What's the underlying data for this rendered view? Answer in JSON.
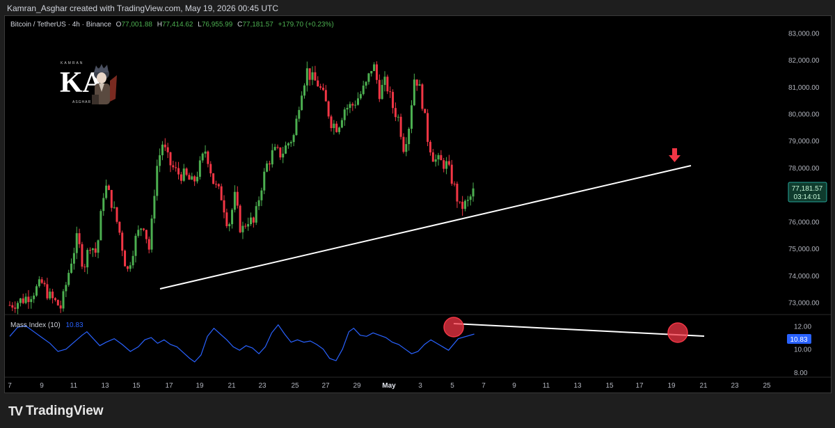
{
  "header": {
    "attribution": "Kamran_Asghar created with TradingView.com, May 19, 2026 00:45 UTC"
  },
  "footer": {
    "brand": "TradingView"
  },
  "logo": {
    "letters": "KA",
    "top": "KAMRAN",
    "bottom": "ASGHAR"
  },
  "colors": {
    "up": "#4caf50",
    "down": "#f23645",
    "indicator": "#2962ff",
    "trend": "#ffffff"
  },
  "chart_data": [
    {
      "type": "candlestick",
      "symbol": "Bitcoin / TetherUS · 4h · Binance",
      "ohlc": {
        "o_label": "O",
        "o": "77,001.88",
        "h_label": "H",
        "h": "77,414.62",
        "l_label": "L",
        "l": "76,955.99",
        "c_label": "C",
        "c": "77,181.57",
        "change": "+179.70 (+0.23%)"
      },
      "last_price": "77,181.57",
      "countdown": "03:14:01",
      "ylim": [
        72600,
        83500
      ],
      "yticks": [
        "83,000.00",
        "82,000.00",
        "81,000.00",
        "80,000.00",
        "79,000.00",
        "78,000.00",
        "76,000.00",
        "75,000.00",
        "74,000.00",
        "73,000.00"
      ],
      "ytick_values": [
        83000,
        82000,
        81000,
        80000,
        79000,
        78000,
        76000,
        75000,
        74000,
        73000
      ],
      "xlim": [
        6.5,
        26.2
      ],
      "xticks": [
        "7",
        "9",
        "11",
        "13",
        "15",
        "17",
        "19",
        "21",
        "23",
        "25",
        "27",
        "29",
        "May",
        "3",
        "5",
        "7",
        "9",
        "11",
        "13",
        "15",
        "17",
        "19",
        "21",
        "23",
        "25"
      ],
      "xtick_positions": [
        7,
        8.15,
        9.3,
        10.45,
        11.6,
        12.75,
        13.9,
        15.05,
        16.2,
        17.35,
        18.5,
        19.65,
        20.8,
        21.95,
        23.1,
        24.25,
        25.4,
        26.55,
        27.7,
        28.85,
        30,
        31.15,
        32.3,
        33.45,
        34.6
      ],
      "waypoints": [
        [
          7.0,
          72900
        ],
        [
          7.8,
          73100
        ],
        [
          8.3,
          73300
        ],
        [
          9.0,
          73700
        ],
        [
          9.5,
          73200
        ],
        [
          10.2,
          72800
        ],
        [
          10.8,
          74500
        ],
        [
          11.2,
          75400
        ],
        [
          11.6,
          74300
        ],
        [
          12.0,
          75200
        ],
        [
          12.4,
          74800
        ],
        [
          12.9,
          77400
        ],
        [
          13.3,
          76800
        ],
        [
          13.8,
          75700
        ],
        [
          14.3,
          74100
        ],
        [
          14.8,
          75300
        ],
        [
          15.3,
          76000
        ],
        [
          15.7,
          74900
        ],
        [
          16.1,
          77900
        ],
        [
          16.5,
          78900
        ],
        [
          16.9,
          78200
        ],
        [
          17.4,
          77800
        ],
        [
          17.9,
          77700
        ],
        [
          18.4,
          77400
        ],
        [
          18.8,
          78000
        ],
        [
          19.2,
          78700
        ],
        [
          19.7,
          77400
        ],
        [
          20.2,
          76900
        ],
        [
          20.6,
          75800
        ],
        [
          21.0,
          76900
        ],
        [
          21.4,
          75600
        ],
        [
          21.8,
          76100
        ],
        [
          22.2,
          75900
        ],
        [
          22.6,
          77200
        ],
        [
          23.0,
          78100
        ],
        [
          23.4,
          78600
        ],
        [
          23.9,
          78500
        ],
        [
          24.3,
          78900
        ],
        [
          24.7,
          79200
        ],
        [
          25.1,
          80800
        ],
        [
          25.5,
          81600
        ],
        [
          25.8,
          81300
        ],
        [
          26.2,
          81100
        ],
        [
          26.6,
          80500
        ],
        [
          27.0,
          79700
        ],
        [
          27.4,
          79500
        ],
        [
          27.8,
          80200
        ],
        [
          28.3,
          80300
        ],
        [
          28.8,
          80700
        ],
        [
          29.2,
          81100
        ],
        [
          29.6,
          81900
        ],
        [
          30.0,
          80800
        ],
        [
          30.4,
          81200
        ],
        [
          30.8,
          80300
        ],
        [
          31.2,
          79800
        ],
        [
          31.5,
          78800
        ],
        [
          31.8,
          79400
        ],
        [
          32.2,
          81500
        ],
        [
          32.6,
          80700
        ],
        [
          33.0,
          79100
        ],
        [
          33.4,
          78300
        ],
        [
          33.8,
          78200
        ],
        [
          34.2,
          78100
        ],
        [
          34.6,
          77400
        ],
        [
          35.0,
          76500
        ],
        [
          35.5,
          76700
        ],
        [
          35.9,
          77180
        ]
      ],
      "last_day": 35.9,
      "trendlines": [
        {
          "from": [
            13.85,
            73300
          ],
          "to": [
            42.8,
            78000
          ]
        }
      ],
      "annotations": [
        {
          "type": "arrow-down",
          "color": "#f23645",
          "x": 41.5,
          "y": 78400
        }
      ]
    },
    {
      "type": "line",
      "name": "Mass Index (10)",
      "last_value": "10.83",
      "ylim": [
        7.7,
        12.8
      ],
      "yticks": [
        "12.00",
        "10.00",
        "8.00"
      ],
      "ytick_values": [
        12,
        10,
        8
      ],
      "points": [
        [
          7.0,
          11.1
        ],
        [
          7.5,
          11.9
        ],
        [
          8.0,
          12.0
        ],
        [
          8.5,
          11.5
        ],
        [
          9.0,
          11.0
        ],
        [
          9.5,
          10.5
        ],
        [
          10.0,
          9.8
        ],
        [
          10.5,
          10.0
        ],
        [
          11.0,
          10.6
        ],
        [
          11.5,
          11.2
        ],
        [
          11.8,
          11.5
        ],
        [
          12.2,
          10.9
        ],
        [
          12.6,
          10.3
        ],
        [
          13.0,
          10.6
        ],
        [
          13.5,
          10.9
        ],
        [
          14.0,
          10.4
        ],
        [
          14.5,
          9.8
        ],
        [
          15.0,
          10.2
        ],
        [
          15.4,
          10.8
        ],
        [
          15.8,
          11.0
        ],
        [
          16.2,
          10.5
        ],
        [
          16.6,
          10.8
        ],
        [
          17.0,
          10.4
        ],
        [
          17.4,
          10.2
        ],
        [
          17.8,
          9.7
        ],
        [
          18.2,
          9.2
        ],
        [
          18.5,
          8.9
        ],
        [
          18.9,
          9.5
        ],
        [
          19.3,
          11.1
        ],
        [
          19.7,
          11.8
        ],
        [
          20.1,
          11.3
        ],
        [
          20.5,
          10.8
        ],
        [
          20.9,
          10.2
        ],
        [
          21.3,
          9.9
        ],
        [
          21.7,
          10.3
        ],
        [
          22.1,
          10.1
        ],
        [
          22.5,
          9.6
        ],
        [
          22.9,
          10.2
        ],
        [
          23.3,
          11.4
        ],
        [
          23.7,
          12.1
        ],
        [
          24.1,
          11.3
        ],
        [
          24.5,
          10.6
        ],
        [
          24.9,
          10.8
        ],
        [
          25.3,
          10.6
        ],
        [
          25.7,
          10.7
        ],
        [
          26.1,
          10.4
        ],
        [
          26.5,
          10.0
        ],
        [
          26.9,
          9.2
        ],
        [
          27.3,
          9.0
        ],
        [
          27.7,
          10.0
        ],
        [
          28.1,
          11.5
        ],
        [
          28.4,
          11.8
        ],
        [
          28.8,
          11.2
        ],
        [
          29.2,
          11.1
        ],
        [
          29.6,
          11.4
        ],
        [
          30.0,
          11.2
        ],
        [
          30.4,
          11.0
        ],
        [
          30.8,
          10.6
        ],
        [
          31.2,
          10.4
        ],
        [
          31.6,
          10.0
        ],
        [
          32.0,
          9.6
        ],
        [
          32.4,
          9.8
        ],
        [
          32.8,
          10.4
        ],
        [
          33.2,
          10.8
        ]
      ],
      "trendlines": [
        {
          "from": [
            23.7,
            12.1
          ],
          "to": [
            43.5,
            11.4
          ]
        }
      ],
      "circles": [
        {
          "x": 23.7,
          "y": 12.0
        },
        {
          "x": 41.6,
          "y": 11.3
        }
      ]
    }
  ]
}
